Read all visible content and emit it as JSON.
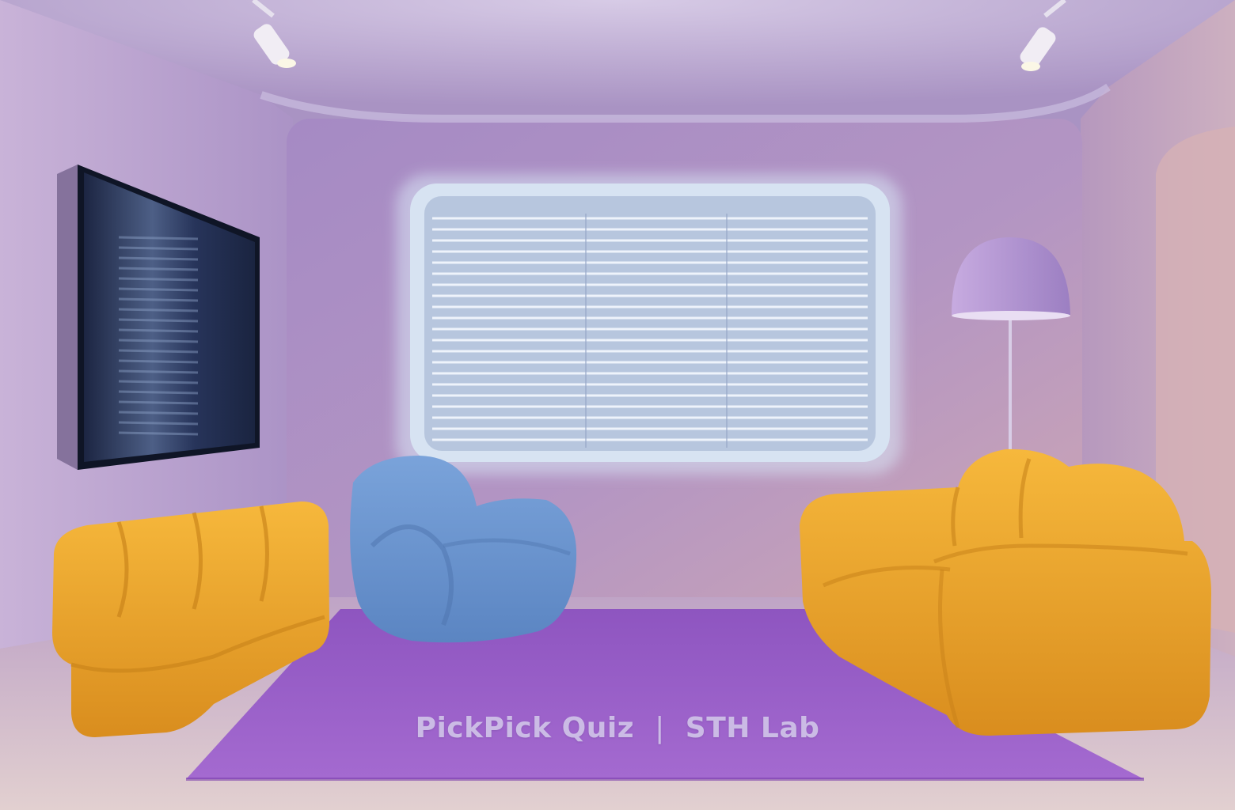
{
  "watermark": {
    "left": "PickPick Quiz",
    "separator": "|",
    "right": "STH Lab"
  },
  "colors": {
    "wall": "#b79fcc",
    "back_wall": "#a98bbd",
    "ceiling": "#c2b1d6",
    "rug": "#9a5fc6",
    "floor": "#d9c6cf",
    "sofa": "#f0a92c",
    "armchair": "#6f98d2",
    "window_blinds": "#c9d6ea",
    "tv_screen": "#1d2944",
    "lamp": "#b59ad2"
  },
  "scene": {
    "objects": [
      "ceiling-spotlight-icon",
      "wall-tv",
      "window-blinds",
      "floor-lamp",
      "yellow-sideboard",
      "blue-armchair",
      "yellow-sofa",
      "purple-rug"
    ]
  }
}
